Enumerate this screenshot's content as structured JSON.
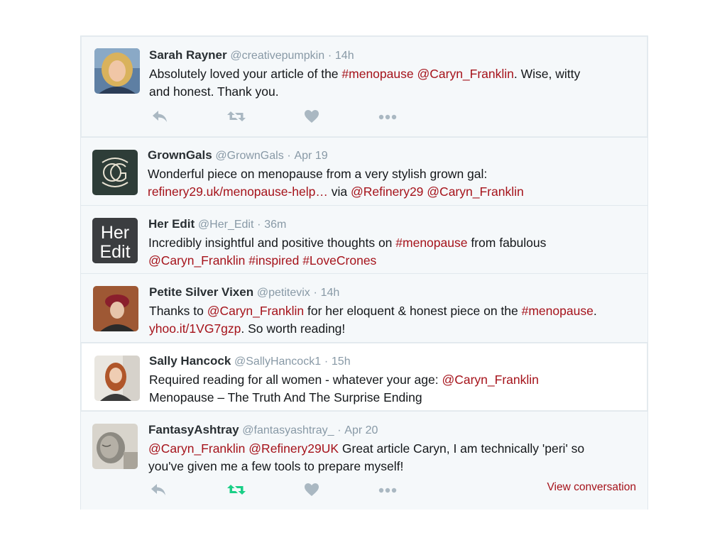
{
  "tweets": [
    {
      "name": "Sarah Rayner",
      "handle": "@creativepumpkin",
      "sep": "·",
      "time": "14h",
      "line1": [
        {
          "t": "Absolutely loved your article of the ",
          "link": false
        },
        {
          "t": "#menopause",
          "link": true
        },
        {
          "t": " ",
          "link": false
        },
        {
          "t": "@Caryn_Franklin",
          "link": true
        },
        {
          "t": ". Wise, witty",
          "link": false
        }
      ],
      "line2": [
        {
          "t": "and honest. Thank you.",
          "link": false
        }
      ]
    },
    {
      "name": "GrownGals",
      "handle": "@GrownGals",
      "sep": "·",
      "time": "Apr 19",
      "line1": [
        {
          "t": "Wonderful piece on menopause from a very stylish grown gal:",
          "link": false
        }
      ],
      "line2": [
        {
          "t": "refinery29.uk/menopause-help…",
          "link": true
        },
        {
          "t": " via ",
          "link": false
        },
        {
          "t": "@Refinery29",
          "link": true
        },
        {
          "t": " ",
          "link": false
        },
        {
          "t": "@Caryn_Franklin",
          "link": true
        }
      ]
    },
    {
      "name": "Her Edit",
      "handle": "@Her_Edit",
      "sep": "·",
      "time": "36m",
      "avatar_text_1": "Her",
      "avatar_text_2": "Edit",
      "line1": [
        {
          "t": "Incredibly insightful and positive thoughts on ",
          "link": false
        },
        {
          "t": "#menopause",
          "link": true
        },
        {
          "t": " from fabulous",
          "link": false
        }
      ],
      "line2": [
        {
          "t": "@Caryn_Franklin",
          "link": true
        },
        {
          "t": " ",
          "link": false
        },
        {
          "t": "#inspired",
          "link": true
        },
        {
          "t": " ",
          "link": false
        },
        {
          "t": "#LoveCrones",
          "link": true
        }
      ]
    },
    {
      "name": "Petite Silver Vixen",
      "handle": "@petitevix",
      "sep": "·",
      "time": "14h",
      "line1": [
        {
          "t": "Thanks to ",
          "link": false
        },
        {
          "t": "@Caryn_Franklin",
          "link": true
        },
        {
          "t": " for her eloquent & honest piece on the ",
          "link": false
        },
        {
          "t": "#menopause",
          "link": true
        },
        {
          "t": ".",
          "link": false
        }
      ],
      "line2": [
        {
          "t": "yhoo.it/1VG7gzp",
          "link": true
        },
        {
          "t": ". So worth reading!",
          "link": false
        }
      ]
    },
    {
      "name": "Sally Hancock",
      "handle": "@SallyHancock1",
      "sep": "·",
      "time": "15h",
      "line1": [
        {
          "t": "Required reading for all women - whatever your age: ",
          "link": false
        },
        {
          "t": "@Caryn_Franklin",
          "link": true
        }
      ],
      "line2": [
        {
          "t": "Menopause – The Truth And The Surprise Ending",
          "link": false
        }
      ]
    },
    {
      "name": "FantasyAshtray",
      "handle": "@fantasyashtray_",
      "sep": "·",
      "time": "Apr 20",
      "line1": [
        {
          "t": "@Caryn_Franklin",
          "link": true
        },
        {
          "t": " ",
          "link": false
        },
        {
          "t": "@Refinery29UK",
          "link": true
        },
        {
          "t": " Great article Caryn, I am technically 'peri' so",
          "link": false
        }
      ],
      "line2": [
        {
          "t": "you've given me a few tools to prepare myself!",
          "link": false
        }
      ],
      "view_conversation": "View conversation"
    }
  ],
  "icons": {
    "reply": "reply-icon",
    "retweet": "retweet-icon",
    "like": "heart-icon",
    "more": "more-icon"
  },
  "colors": {
    "link": "#a5121a",
    "muted": "#8899a6",
    "action_icon": "#aab8c2",
    "retweeted": "#19cf86",
    "background": "#f5f8fa"
  }
}
